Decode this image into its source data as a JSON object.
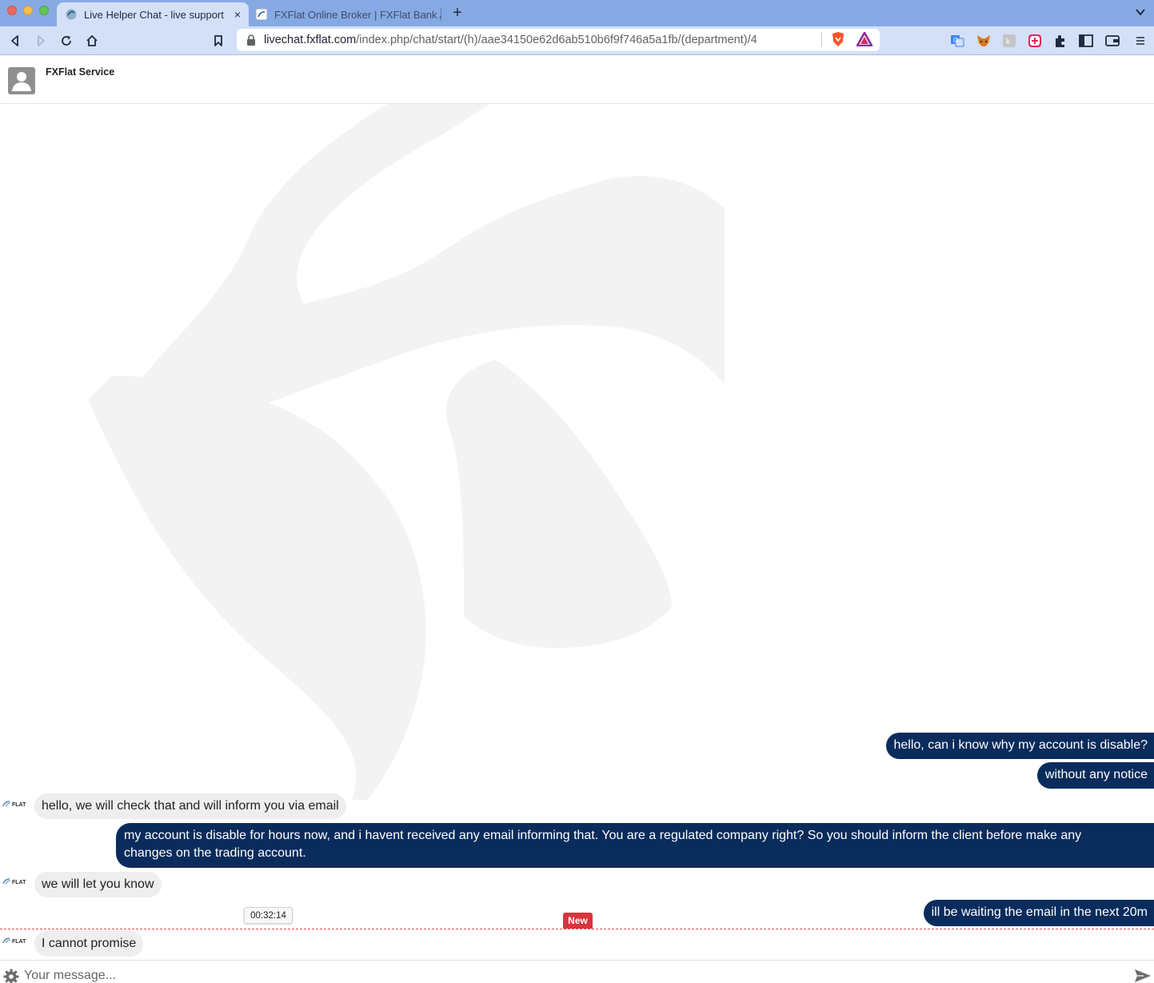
{
  "browser": {
    "tabs": [
      {
        "title": "Live Helper Chat - live support",
        "active": true
      },
      {
        "title": "FXFlat Online Broker | FXFlat Bank A",
        "active": false
      }
    ],
    "close_glyph": "×",
    "new_tab_glyph": "+",
    "url": {
      "host": "livechat.fxflat.com",
      "path": "/index.php/chat/start/(h)/aae34150e62d6ab510b6f9f746a5a1fb/(department)/4"
    },
    "extensions": [
      "translate-icon",
      "metamask-icon",
      "reader-icon",
      "addon-icon",
      "puzzle-icon",
      "sidebar-icon",
      "wallet-icon",
      "menu-icon"
    ]
  },
  "chat": {
    "header_title": "FXFlat Service",
    "operator_logo_text": "FLAT",
    "messages": [
      {
        "side": "out",
        "text": "hello, can i know why my account is disable?"
      },
      {
        "side": "out",
        "text": "without any notice"
      },
      {
        "side": "in",
        "text": "hello, we will check that and will inform you via email"
      },
      {
        "side": "out",
        "text": "my account is disable for hours now, and i havent received any email informing that. You are a regulated company right? So you should inform the client before make any changes on the trading account."
      },
      {
        "side": "in",
        "text": "we will let you know"
      },
      {
        "side": "out",
        "text": "ill be waiting the email in the next 20m"
      },
      {
        "side": "in",
        "text": "I cannot promise"
      }
    ],
    "timestamp_tooltip": "00:32:14",
    "new_badge": "New",
    "composer_placeholder": "Your message...",
    "colors": {
      "outgoing_bubble": "#0a2c5c",
      "incoming_bubble": "#eeeeee",
      "new_badge": "#d9343e",
      "divider": "#d9534f"
    }
  }
}
